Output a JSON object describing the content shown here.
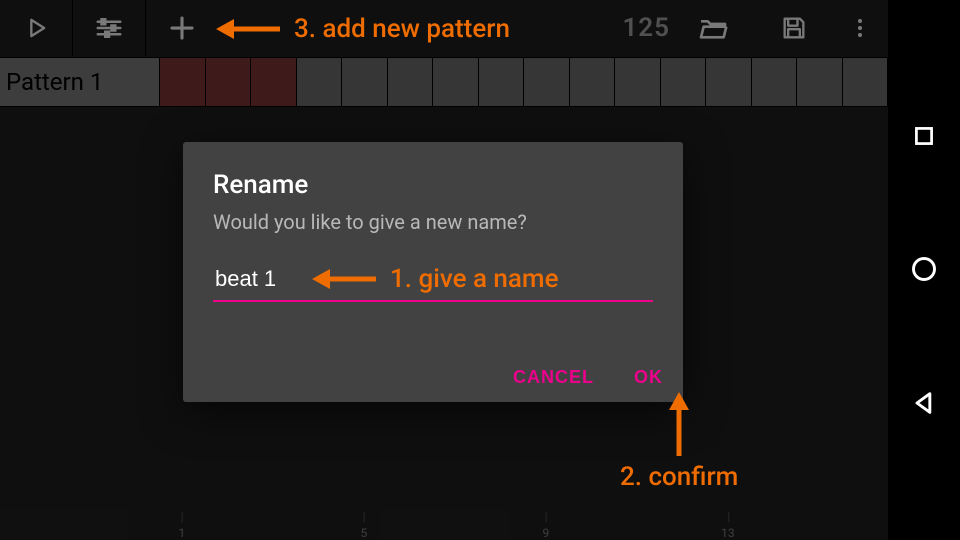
{
  "toolbar": {
    "tempo": "125"
  },
  "pattern": {
    "label": "Pattern 1"
  },
  "ruler": {
    "marks": [
      "1",
      "5",
      "9",
      "13"
    ]
  },
  "dialog": {
    "title": "Rename",
    "message": "Would you like to give a new name?",
    "input_value": "beat 1",
    "cancel": "CANCEL",
    "ok": "OK"
  },
  "annotations": {
    "step1": "1. give a name",
    "step2": "2. confirm",
    "step3": "3. add new pattern"
  },
  "colors": {
    "accent": "#ec008c",
    "annotation": "#ef6c00"
  }
}
